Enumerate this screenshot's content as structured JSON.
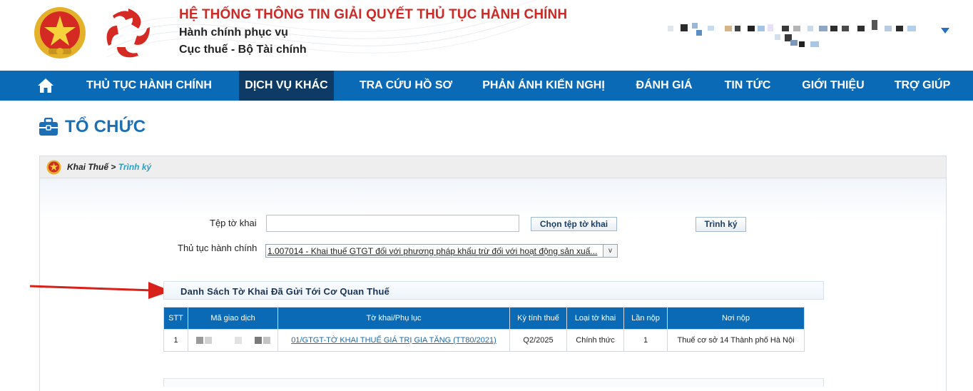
{
  "header": {
    "title": "HỆ THỐNG THÔNG TIN GIẢI QUYẾT THỦ TỤC HÀNH CHÍNH",
    "subtitle1": "Hành chính phục vụ",
    "subtitle2": "Cục thuế - Bộ Tài chính"
  },
  "nav": {
    "items": [
      {
        "label": "THỦ TỤC HÀNH CHÍNH"
      },
      {
        "label": "DỊCH VỤ KHÁC",
        "active": true
      },
      {
        "label": "TRA CỨU HỒ SƠ"
      },
      {
        "label": "PHẢN ÁNH KIẾN NGHỊ"
      },
      {
        "label": "ĐÁNH GIÁ"
      },
      {
        "label": "TIN TỨC"
      },
      {
        "label": "GIỚI THIỆU"
      },
      {
        "label": "TRỢ GIÚP"
      }
    ]
  },
  "page": {
    "title": "TỔ CHỨC"
  },
  "breadcrumb": {
    "part1": "Khai Thuế",
    "separator": " > ",
    "part2": "Trình ký"
  },
  "form": {
    "file_label": "Tệp tờ khai",
    "file_value": "",
    "choose_button": "Chọn tệp tờ khai",
    "sign_button": "Trình ký",
    "procedure_label": "Thủ tục hành chính",
    "procedure_value": "1.007014 - Khai thuế GTGT đối với phương pháp khấu trừ đối với hoạt động sản xuấ...",
    "procedure_arrow": "v"
  },
  "list": {
    "title": "Danh Sách Tờ Khai Đã Gửi Tới Cơ Quan Thuế",
    "columns": [
      "STT",
      "Mã giao dịch",
      "Tờ khai/Phụ lục",
      "Kỳ tính thuế",
      "Loại tờ khai",
      "Lần nộp",
      "Nơi nộp"
    ],
    "rows": [
      {
        "stt": "1",
        "ma_giao_dich": "",
        "to_khai": "01/GTGT-TỜ KHAI THUẾ GIÁ TRỊ GIA TĂNG (TT80/2021)",
        "ky_tinh_thue": "Q2/2025",
        "loai_to_khai": "Chính thức",
        "lan_nop": "1",
        "noi_nop": "Thuế cơ sở 14 Thành phố Hà Nội"
      }
    ]
  },
  "colors": {
    "nav_bg": "#0b6ab6",
    "nav_active_bg": "#0d3b66",
    "title_red": "#cc2a26",
    "page_title_blue": "#1d6fb5",
    "breadcrumb_link": "#2aa0c8",
    "arrow_red": "#d9211c"
  },
  "icons": {
    "emblem": "national-emblem-icon",
    "logo": "star-logo-icon",
    "home": "home-icon",
    "briefcase": "briefcase-icon",
    "user_menu": "caret-down-icon",
    "annotation": "red-arrow-icon"
  }
}
